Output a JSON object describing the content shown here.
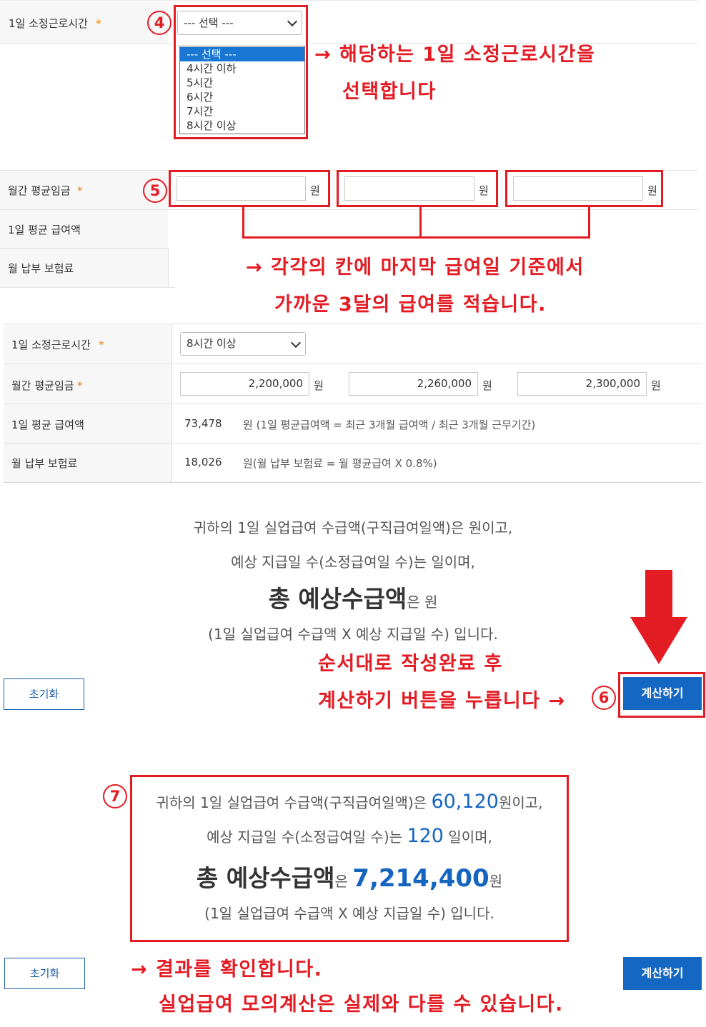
{
  "section4": {
    "label": "1일 소정근로시간",
    "required": "*",
    "step": "4",
    "select_value": "--- 선택 ---",
    "options": [
      "--- 선택 ---",
      "4시간 이하",
      "5시간",
      "6시간",
      "7시간",
      "8시간 이상"
    ],
    "note_line1": "→ 해당하는 1일 소정근로시간을",
    "note_line2": "선택합니다"
  },
  "section5": {
    "step": "5",
    "wage_label": "월간 평균임금",
    "required": "*",
    "unit": "원",
    "daily_label": "1일 평균 급여액",
    "insurance_label": "월 납부 보험료",
    "note_line1": "→ 각각의 칸에 마지막 급여일 기준에서",
    "note_line2": "가까운 3달의 급여를 적습니다."
  },
  "filled_form": {
    "hours_label": "1일 소정근로시간",
    "hours_value": "8시간 이상",
    "wage_label": "월간 평균임금",
    "required": "*",
    "wage_values": [
      "2,200,000",
      "2,260,000",
      "2,300,000"
    ],
    "unit": "원",
    "daily_label": "1일 평균 급여액",
    "daily_value": "73,478",
    "daily_desc": "원 (1일 평균급여액 = 최근 3개월 급여액 / 최근 3개월 근무기간)",
    "insurance_label": "월 납부 보험료",
    "insurance_value": "18,026",
    "insurance_desc": "원(월 납부 보험료 = 월 평균급여 X 0.8%)"
  },
  "result_empty": {
    "line1": "귀하의 1일 실업급여 수급액(구직급여일액)은 원이고,",
    "line2": "예상 지급일 수(소정급여일 수)는 일이며,",
    "line3_big": "총 예상수급액",
    "line3_small": "은 원",
    "line4": "(1일 실업급여 수급액 X 예상 지급일 수) 입니다."
  },
  "section6": {
    "note_line1": "순서대로 작성완료 후",
    "note_line2": "계산하기 버튼을 누릅니다 →",
    "step": "6",
    "reset_label": "초기화",
    "calc_label": "계산하기"
  },
  "result_filled": {
    "step": "7",
    "line1_pre": "귀하의 1일 실업급여 수급액(구직급여일액)은 ",
    "line1_value": "60,120",
    "line1_post": "원이고,",
    "line2_pre": "예상 지급일 수(소정급여일 수)는 ",
    "line2_value": "120",
    "line2_post": " 일이며,",
    "line3_big": "총 예상수급액",
    "line3_mid": "은 ",
    "line3_value": "7,214,400",
    "line3_post": "원",
    "line4": "(1일 실업급여 수급액 X 예상 지급일 수) 입니다."
  },
  "bottom": {
    "reset_label": "초기화",
    "calc_label": "계산하기",
    "note_line1": "→ 결과를 확인합니다.",
    "note_line2": "실업급여 모의계산은 실제와 다를 수 있습니다."
  },
  "colors": {
    "annotation_red": "#e31b23",
    "primary_blue": "#1567c4",
    "result_blue": "#1565c0"
  }
}
